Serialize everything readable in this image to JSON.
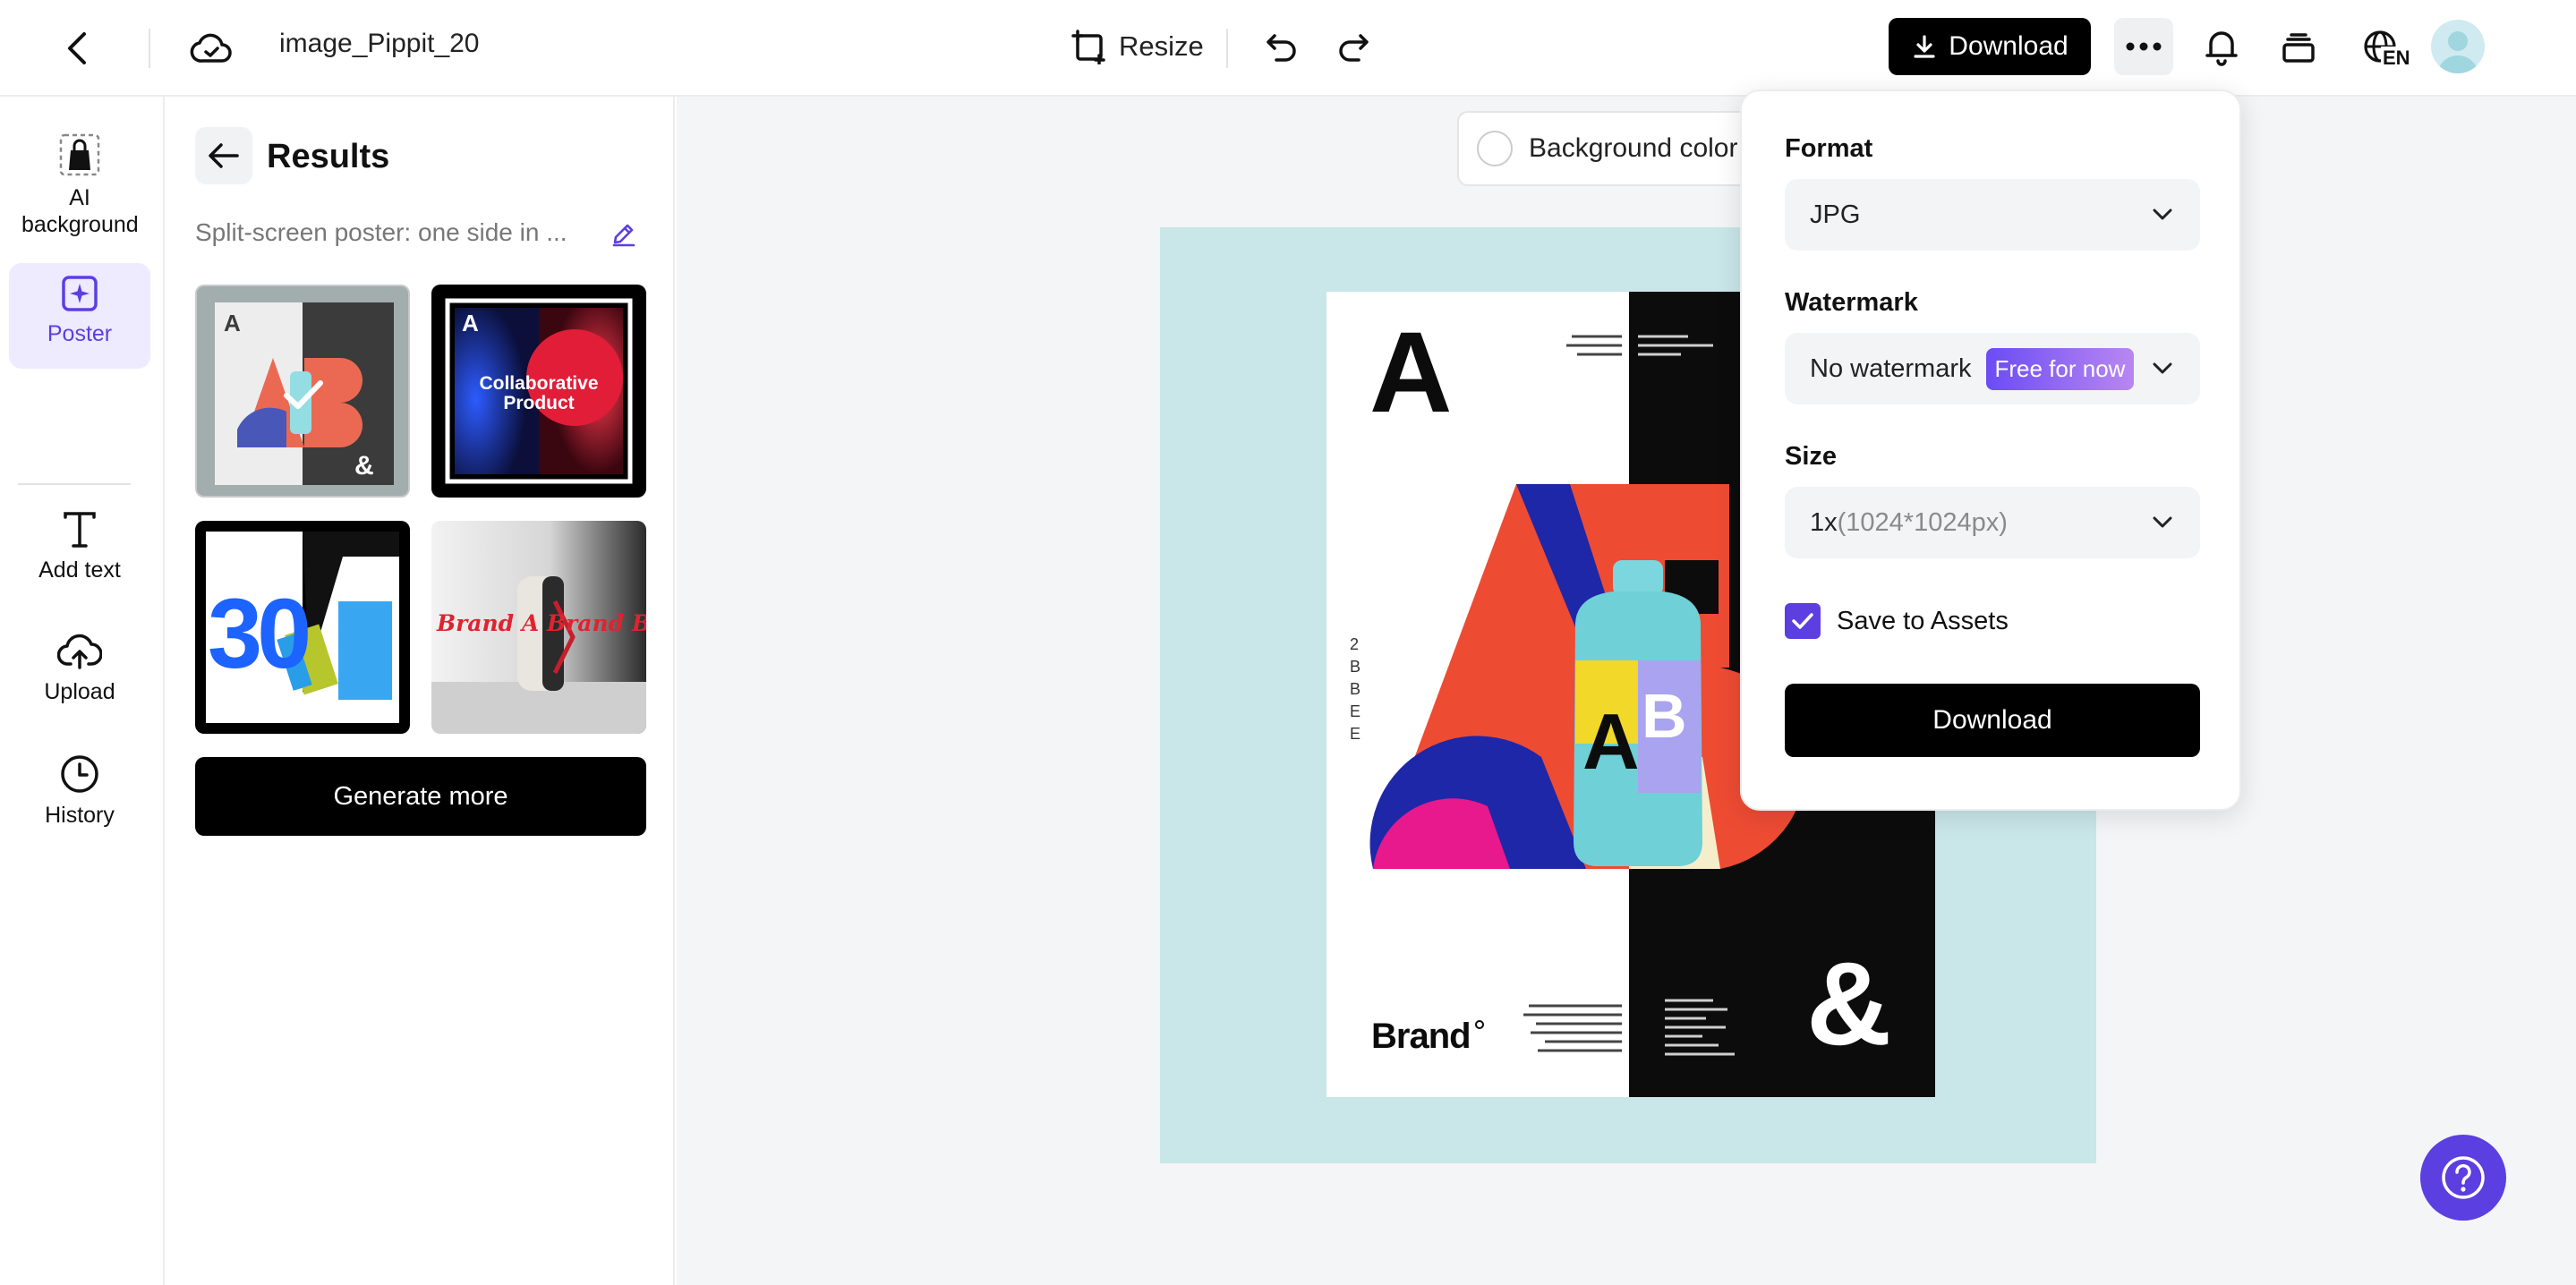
{
  "topbar": {
    "file_name": "image_Pippit_20",
    "resize_label": "Resize",
    "download_label": "Download",
    "language_code": "EN"
  },
  "leftnav": {
    "items": [
      {
        "label": "AI background",
        "icon": "bag-icon"
      },
      {
        "label": "Poster",
        "icon": "poster-sparkle-icon"
      },
      {
        "label": "Add text",
        "icon": "text-icon"
      },
      {
        "label": "Upload",
        "icon": "cloud-upload-icon"
      },
      {
        "label": "History",
        "icon": "clock-icon"
      }
    ],
    "active": "Poster"
  },
  "results": {
    "title": "Results",
    "prompt": "Split-screen poster: one side in ...",
    "thumbnails": [
      {
        "caption": "",
        "selected": true
      },
      {
        "caption": "Collaborative Product",
        "selected": false
      },
      {
        "caption": "30",
        "selected": false
      },
      {
        "caption": "Brand A Brand B",
        "selected": false
      }
    ],
    "generate_more_label": "Generate more"
  },
  "canvas": {
    "background_color_label": "Background color",
    "poster": {
      "letter_a": "A",
      "vertical_chars": [
        "2",
        "B",
        "B",
        "E",
        "E"
      ],
      "brand": "Brand",
      "ampersand": "&",
      "bottle_a": "A",
      "bottle_b": "B"
    }
  },
  "download_panel": {
    "format_label": "Format",
    "format_value": "JPG",
    "watermark_label": "Watermark",
    "watermark_value": "No watermark",
    "watermark_badge": "Free for now",
    "size_label": "Size",
    "size_value": "1x",
    "size_hint": "(1024*1024px)",
    "save_to_assets_label": "Save to Assets",
    "save_to_assets_checked": true,
    "download_label": "Download"
  },
  "colors": {
    "accent": "#5b3fe0",
    "canvas_frame": "#c9e6e8",
    "primary_button": "#000000"
  }
}
